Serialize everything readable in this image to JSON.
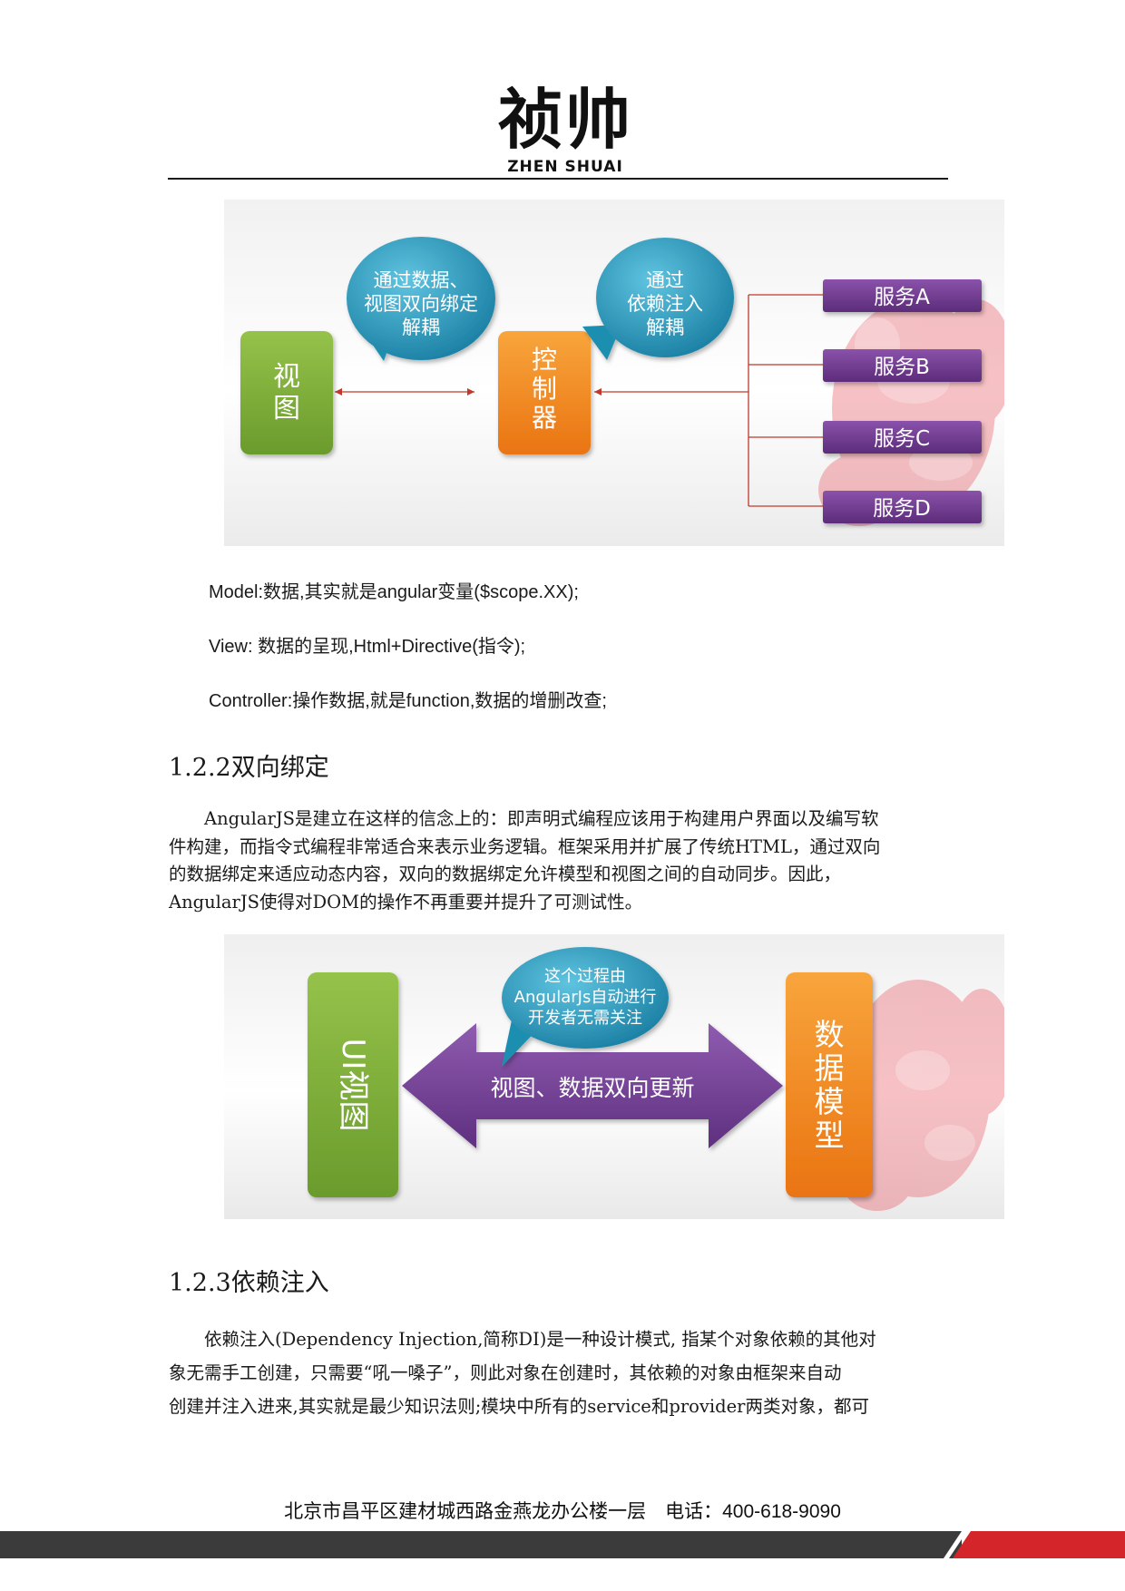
{
  "header": {
    "logo_cn": "祯帅",
    "logo_en": "ZHEN SHUAI"
  },
  "figure1": {
    "view_label": "视图",
    "controller_label": "控制器",
    "bubble_left": [
      "通过数据、",
      "视图双向绑定",
      "解耦"
    ],
    "bubble_right": [
      "通过",
      "依赖注入",
      "解耦"
    ],
    "services": [
      "服务A",
      "服务B",
      "服务C",
      "服务D"
    ]
  },
  "mvc": {
    "model": "Model:数据,其实就是angular变量($scope.XX);",
    "view": "View:  数据的呈现,Html+Directive(指令);",
    "controller": "Controller:操作数据,就是function,数据的增删改查;"
  },
  "section_122": {
    "heading": "1.2.2双向绑定",
    "lines": [
      "　　AngularJS是建立在这样的信念上的：即声明式编程应该用于构建用户界面以及编写软",
      "件构建，而指令式编程非常适合来表示业务逻辑。框架采用并扩展了传统HTML，通过双向",
      "的数据绑定来适应动态内容，双向的数据绑定允许模型和视图之间的自动同步。因此，",
      "AngularJS使得对DOM的操作不再重要并提升了可测试性。"
    ]
  },
  "figure2": {
    "ui_view_label": "UI视图",
    "data_model_label": "数据模型",
    "arrow_label": "视图、数据双向更新",
    "bubble": [
      "这个过程由",
      "AngularJs自动进行",
      "开发者无需关注"
    ]
  },
  "section_123": {
    "heading": "1.2.3依赖注入",
    "lines": [
      "　　依赖注入(Dependency Injection,简称DI)是一种设计模式, 指某个对象依赖的其他对",
      "象无需手工创建，只需要“吼一嗓子”，则此对象在创建时，其依赖的对象由框架来自动",
      "创建并注入进来,其实就是最少知识法则;模块中所有的service和provider两类对象，都可"
    ]
  },
  "footer": {
    "address": "北京市昌平区建材城西路金燕龙办公楼一层　电话：400-618-9090"
  },
  "colors": {
    "green": "#7fae3a",
    "orange": "#f28a1e",
    "purple": "#6f3a8e",
    "teal": "#1f8fb0",
    "connector_red": "#c0392b",
    "footer_dark": "#3b3b3b",
    "footer_red": "#d3252a"
  }
}
